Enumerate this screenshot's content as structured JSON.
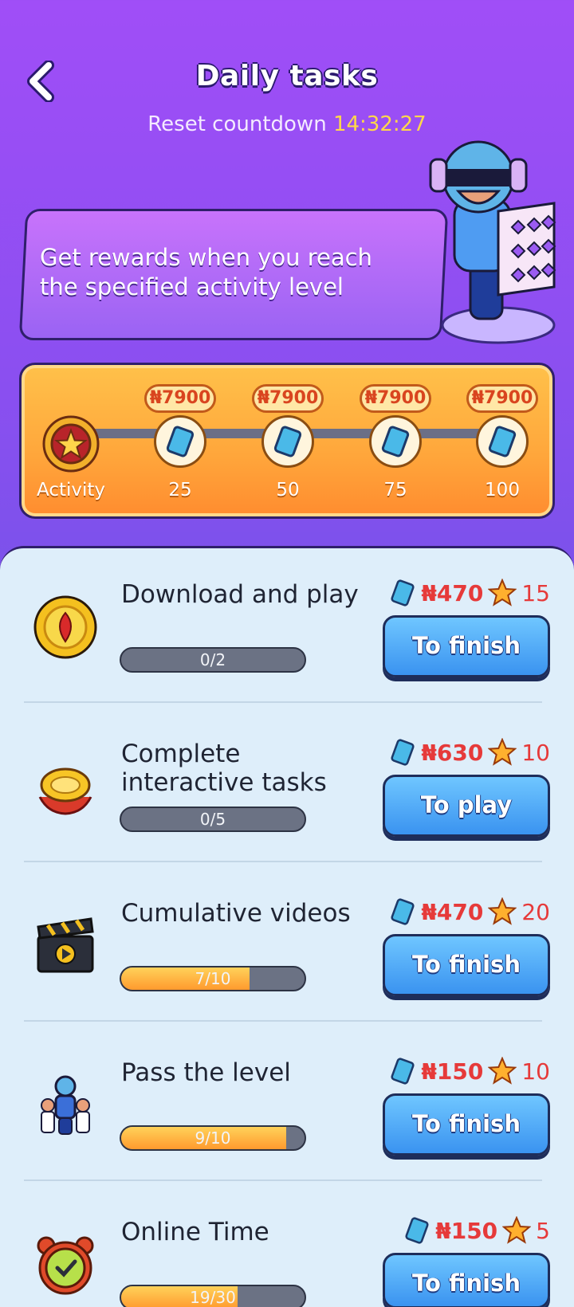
{
  "header": {
    "title": "Daily tasks",
    "countdown_label": "Reset countdown",
    "countdown_time": "14:32:27"
  },
  "banner": {
    "text": "Get rewards when you reach the specified activity level"
  },
  "activity": {
    "label": "Activity",
    "milestones": [
      {
        "reward": "₦7900",
        "level": "25"
      },
      {
        "reward": "₦7900",
        "level": "50"
      },
      {
        "reward": "₦7900",
        "level": "75"
      },
      {
        "reward": "₦7900",
        "level": "100"
      }
    ]
  },
  "tasks": [
    {
      "name": "Download and play",
      "progress_text": "0/2",
      "progress": 0.0,
      "cash": "₦470",
      "stars": "15",
      "button": "To finish",
      "icon": "download-coin-icon"
    },
    {
      "name": "Complete interactive tasks",
      "progress_text": "0/5",
      "progress": 0.0,
      "cash": "₦630",
      "stars": "10",
      "button": "To play",
      "icon": "ring-gift-icon"
    },
    {
      "name": "Cumulative videos",
      "progress_text": "7/10",
      "progress": 0.7,
      "cash": "₦470",
      "stars": "20",
      "button": "To finish",
      "icon": "clapperboard-icon"
    },
    {
      "name": "Pass the level",
      "progress_text": "9/10",
      "progress": 0.9,
      "cash": "₦150",
      "stars": "10",
      "button": "To finish",
      "icon": "team-players-icon"
    },
    {
      "name": "Online Time",
      "progress_text": "19/30",
      "progress": 0.633,
      "cash": "₦150",
      "stars": "5",
      "button": "To finish",
      "icon": "alarm-clock-icon"
    }
  ],
  "colors": {
    "accent_red": "#e63a3a",
    "button_blue": "#3a93f0",
    "countdown_yellow": "#ffd84a"
  }
}
